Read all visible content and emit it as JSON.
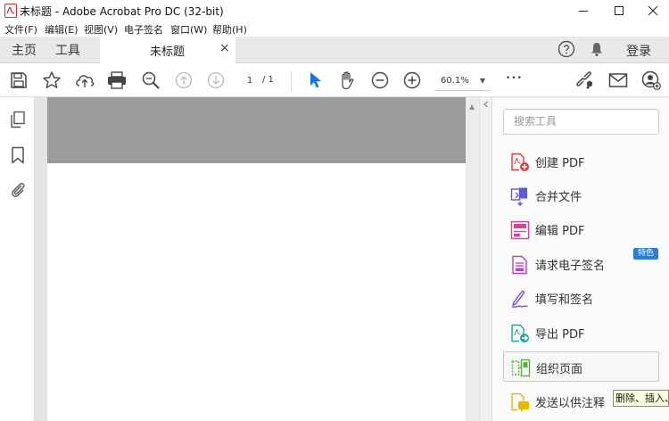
{
  "window": {
    "title": "未标题 - Adobe Acrobat Pro DC (32-bit)",
    "controls": [
      "minimize",
      "maximize",
      "close"
    ]
  },
  "menu": {
    "items": [
      "文件(F)",
      "编辑(E)",
      "视图(V)",
      "电子签名",
      "窗口(W)",
      "帮助(H)"
    ]
  },
  "tabs": {
    "home": "主页",
    "tools": "工具",
    "document": "未标题",
    "close_glyph": "×",
    "login": "登录"
  },
  "toolbar": {
    "page_current": "1",
    "page_total": "/ 1",
    "zoom": "60.1%",
    "more": "•••"
  },
  "tools_pane": {
    "search_placeholder": "搜索工具",
    "items": [
      {
        "label": "创建 PDF",
        "icon": "create-pdf-icon",
        "color": "#e03c3c"
      },
      {
        "label": "合并文件",
        "icon": "combine-files-icon",
        "color": "#5b5bd6"
      },
      {
        "label": "编辑 PDF",
        "icon": "edit-pdf-icon",
        "color": "#d9449a"
      },
      {
        "label": "请求电子签名",
        "icon": "request-signature-icon",
        "color": "#c03fc8"
      },
      {
        "label": "填写和签名",
        "icon": "fill-sign-icon",
        "color": "#7a50d8"
      },
      {
        "label": "导出 PDF",
        "icon": "export-pdf-icon",
        "color": "#1ea69a"
      },
      {
        "label": "组织页面",
        "icon": "organize-pages-icon",
        "color": "#57b336"
      },
      {
        "label": "发送以供注释",
        "icon": "send-comments-icon",
        "color": "#e6b800"
      }
    ],
    "badge": "特色",
    "tooltip": "删除、插入、"
  },
  "colors": {
    "accent_blue": "#2d7dd2",
    "tab_bar": "#e9e9e9",
    "page_gray": "#9b9b9b"
  }
}
